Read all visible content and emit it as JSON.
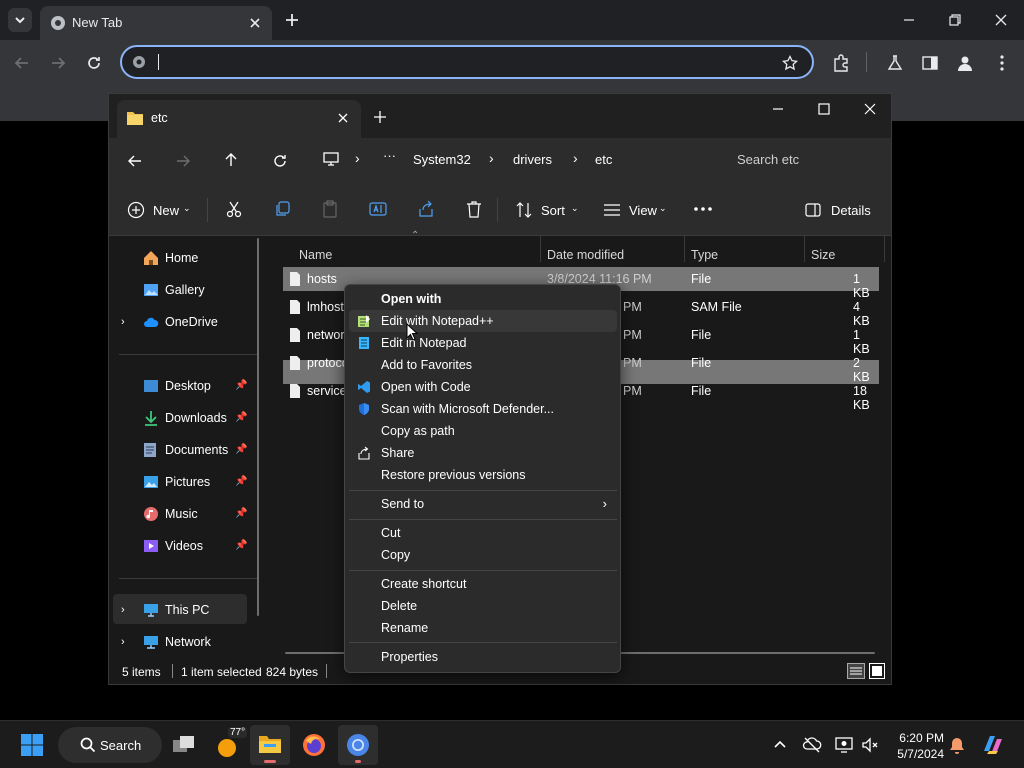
{
  "chrome": {
    "tab_title": "New Tab",
    "omnibox_value": ""
  },
  "explorer": {
    "tab_title": "etc",
    "breadcrumb": [
      "System32",
      "drivers",
      "etc"
    ],
    "search_placeholder": "Search etc",
    "cmd": {
      "new": "New",
      "sort": "Sort",
      "view": "View",
      "details": "Details"
    },
    "nav": {
      "home": "Home",
      "gallery": "Gallery",
      "onedrive": "OneDrive",
      "desktop": "Desktop",
      "downloads": "Downloads",
      "documents": "Documents",
      "pictures": "Pictures",
      "music": "Music",
      "videos": "Videos",
      "thispc": "This PC",
      "network": "Network"
    },
    "columns": {
      "name": "Name",
      "date": "Date modified",
      "type": "Type",
      "size": "Size"
    },
    "files": [
      {
        "name": "hosts",
        "date": "3/8/2024 11:16 PM",
        "type": "File",
        "size": "1 KB"
      },
      {
        "name": "lmhosts",
        "date": "PM",
        "type": "SAM File",
        "size": "4 KB"
      },
      {
        "name": "networks",
        "date": "PM",
        "type": "File",
        "size": "1 KB"
      },
      {
        "name": "protocol",
        "date": "PM",
        "type": "File",
        "size": "2 KB"
      },
      {
        "name": "services",
        "date": "PM",
        "type": "File",
        "size": "18 KB"
      }
    ],
    "status": {
      "items": "5 items",
      "selected": "1 item selected",
      "bytes": "824 bytes"
    }
  },
  "context_menu": {
    "open_with": "Open with",
    "edit_notepadpp": "Edit with Notepad++",
    "edit_notepad": "Edit in Notepad",
    "add_favorites": "Add to Favorites",
    "open_code": "Open with Code",
    "scan_defender": "Scan with Microsoft Defender...",
    "copy_path": "Copy as path",
    "share": "Share",
    "restore": "Restore previous versions",
    "send_to": "Send to",
    "cut": "Cut",
    "copy": "Copy",
    "create_shortcut": "Create shortcut",
    "delete": "Delete",
    "rename": "Rename",
    "properties": "Properties"
  },
  "taskbar": {
    "search": "Search",
    "weather_temp": "77°",
    "time": "6:20 PM",
    "date": "5/7/2024"
  },
  "colors": {
    "accent": "#8ab4f8",
    "folder": "#f2c14e",
    "onedrive": "#1e90ff"
  }
}
